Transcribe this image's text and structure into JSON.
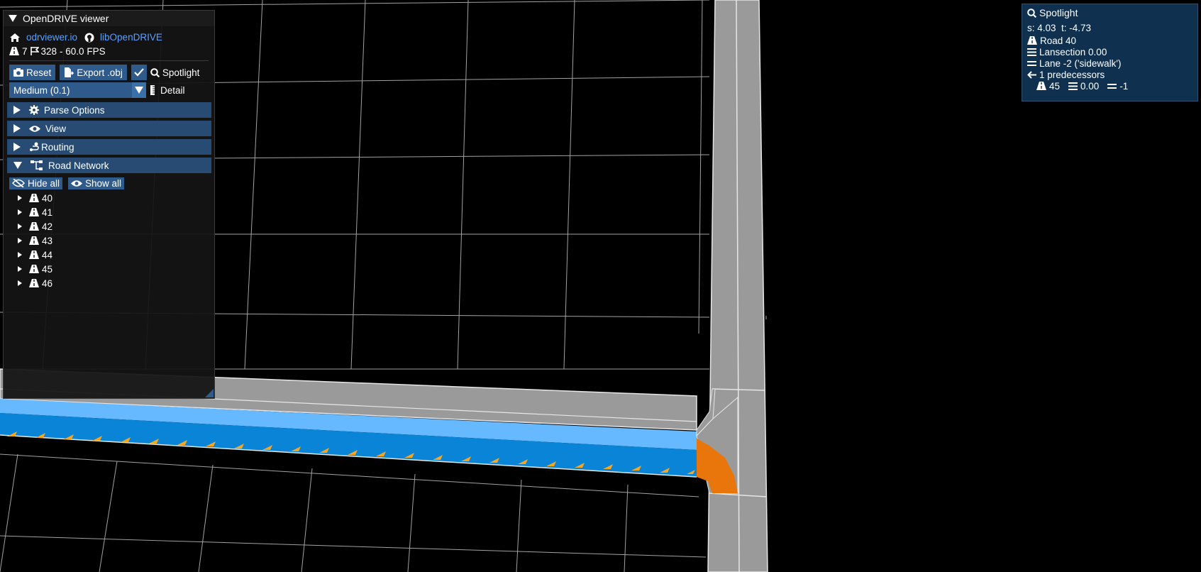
{
  "panel": {
    "title": "OpenDRIVE viewer",
    "links": {
      "home": "odrviewer.io",
      "github": "libOpenDRIVE"
    },
    "stats": {
      "roads": "7",
      "junction_count": "328",
      "fps": "- 60.0 FPS"
    },
    "buttons": {
      "reset": "Reset",
      "export": "Export .obj",
      "spotlight": "Spotlight",
      "spotlight_checked": true
    },
    "detail": {
      "value": "Medium (0.1)",
      "label": "Detail"
    },
    "sections": [
      {
        "label": "Parse Options",
        "icon": "gear-icon",
        "expanded": false
      },
      {
        "label": "View",
        "icon": "eye-icon",
        "expanded": false
      },
      {
        "label": "Routing",
        "icon": "route-icon",
        "expanded": false
      },
      {
        "label": "Road Network",
        "icon": "network-icon",
        "expanded": true
      }
    ],
    "road_network": {
      "hide_all": "Hide all",
      "show_all": "Show all",
      "roads": [
        "40",
        "41",
        "42",
        "43",
        "44",
        "45",
        "46"
      ]
    }
  },
  "spotlight": {
    "title": "Spotlight",
    "coords": "s: 4.03  t: -4.73",
    "road": "Road 40",
    "lanesection": "Lansection 0.00",
    "lane": "Lane -2 ('sidewalk')",
    "predecessors": "1 predecessors",
    "pred_road": "45",
    "pred_lanesection": "0.00",
    "pred_lane": "-1"
  },
  "colors": {
    "panel_bg": "#141414",
    "button": "#2f5b8c",
    "header": "#274b73",
    "link": "#5aa0ff",
    "road_gray": "#9a9a9a",
    "lane_blue": "#0a84d6",
    "lane_light_blue": "#66b8ff",
    "highlight_orange": "#e8760a",
    "spotlight_bg": "#10304f"
  }
}
